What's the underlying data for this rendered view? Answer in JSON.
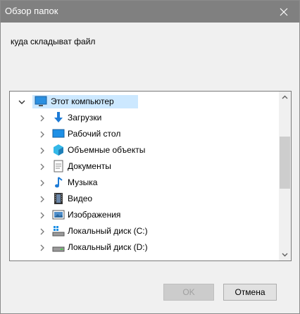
{
  "window": {
    "title": "Обзор папок"
  },
  "prompt": "куда складыват файл",
  "tree": {
    "items": [
      {
        "label": "Этот компьютер",
        "icon": "computer-icon",
        "expanded": true,
        "selected": true
      },
      {
        "label": "Загрузки",
        "icon": "downloads-icon"
      },
      {
        "label": "Рабочий стол",
        "icon": "desktop-icon"
      },
      {
        "label": "Объемные объекты",
        "icon": "3d-objects-icon"
      },
      {
        "label": "Документы",
        "icon": "documents-icon"
      },
      {
        "label": "Музыка",
        "icon": "music-icon"
      },
      {
        "label": "Видео",
        "icon": "video-icon"
      },
      {
        "label": "Изображения",
        "icon": "pictures-icon"
      },
      {
        "label": "Локальный диск (C:)",
        "icon": "system-drive-icon"
      },
      {
        "label": "Локальный диск (D:)",
        "icon": "drive-icon"
      }
    ]
  },
  "buttons": {
    "ok": "OK",
    "cancel": "Отмена"
  },
  "colors": {
    "titlebar": "#808080",
    "selection": "#cce8ff",
    "accent": "#1e7bd6"
  }
}
